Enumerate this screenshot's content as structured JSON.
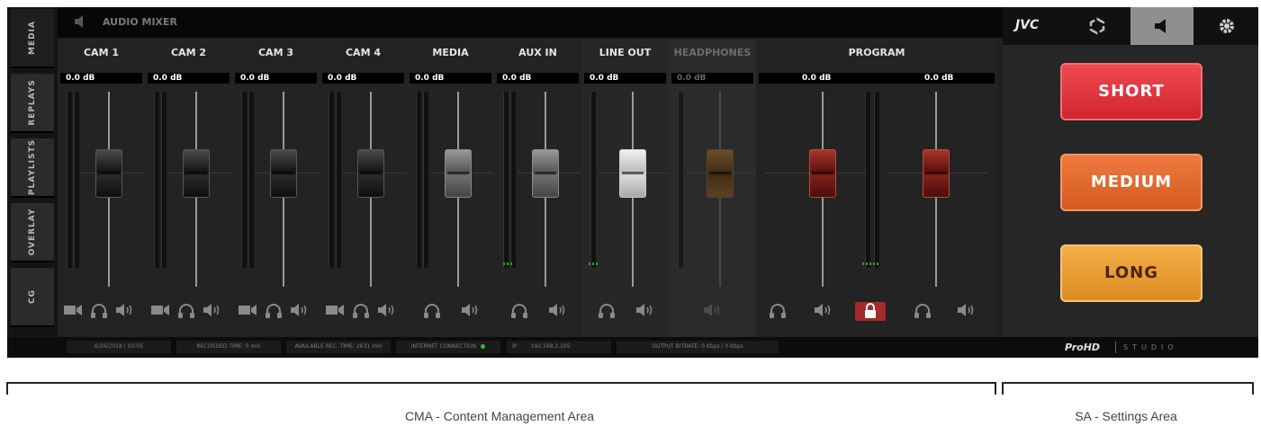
{
  "header": {
    "title": "AUDIO MIXER"
  },
  "left_tabs": [
    {
      "label": "MEDIA"
    },
    {
      "label": "REPLAYS"
    },
    {
      "label": "PLAYLISTS"
    },
    {
      "label": "OVERLAY"
    },
    {
      "label": "CG"
    }
  ],
  "channels": [
    {
      "name": "CAM 1",
      "db": "0.0 dB"
    },
    {
      "name": "CAM 2",
      "db": "0.0 dB"
    },
    {
      "name": "CAM 3",
      "db": "0.0 dB"
    },
    {
      "name": "CAM 4",
      "db": "0.0 dB"
    },
    {
      "name": "MEDIA",
      "db": "0.0 dB"
    },
    {
      "name": "AUX IN",
      "db": "0.0 dB"
    },
    {
      "name": "LINE OUT",
      "db": "0.0 dB"
    },
    {
      "name": "HEADPHONES",
      "db": "0.0 dB"
    },
    {
      "name": "PROGRAM",
      "db_left": "0.0 dB",
      "db_right": "0.0 dB"
    }
  ],
  "status": {
    "datetime": "6/26/2018 | 03:05",
    "recorded_time": "RECORDED TIME: 0 min",
    "available_rec_time": "AVAILABLE REC. TIME: 2631 min",
    "internet": "INTERNET CONNECTION",
    "ip_label": "IP",
    "ip_value": "192.168.2.105",
    "bitrate": "OUTPUT BITRATE:  0 Kbps / 0 Kbps"
  },
  "branding": {
    "logo": "ProHD",
    "studio": "STUDIO",
    "jvc": "JVC"
  },
  "settings": {
    "short": "SHORT",
    "medium": "MEDIUM",
    "long": "LONG"
  },
  "annotations": {
    "cma": "CMA - Content Management Area",
    "sa": "SA - Settings Area"
  },
  "colors": {
    "short": "#e0313c",
    "medium": "#e0652d",
    "long": "#ea9c34",
    "fader_red": "#7e2018",
    "meter_green": "#2e9d2e"
  }
}
